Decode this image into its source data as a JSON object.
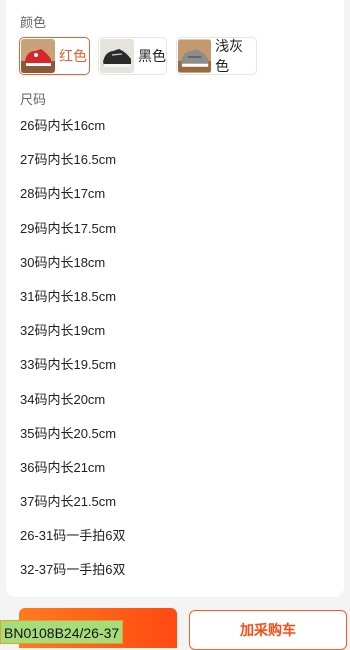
{
  "color_section": {
    "label": "颜色",
    "options": [
      {
        "label": "红色",
        "selected": true
      },
      {
        "label": "黑色",
        "selected": false
      },
      {
        "label": "浅灰色",
        "selected": false
      }
    ]
  },
  "size_section": {
    "label": "尺码",
    "options": [
      "26码内长16cm",
      "27码内长16.5cm",
      "28码内长17cm",
      "29码内长17.5cm",
      "30码内长18cm",
      "31码内长18.5cm",
      "32码内长19cm",
      "33码内长19.5cm",
      "34码内长20cm",
      "35码内长20.5cm",
      "36码内长21cm",
      "37码内长21.5cm",
      "26-31码一手拍6双",
      "32-37码一手拍6双"
    ]
  },
  "bottom": {
    "cart_label": "加采购车",
    "sku_tag": "BN0108B24/26-37",
    "accent_color": "#ff5a1f"
  }
}
